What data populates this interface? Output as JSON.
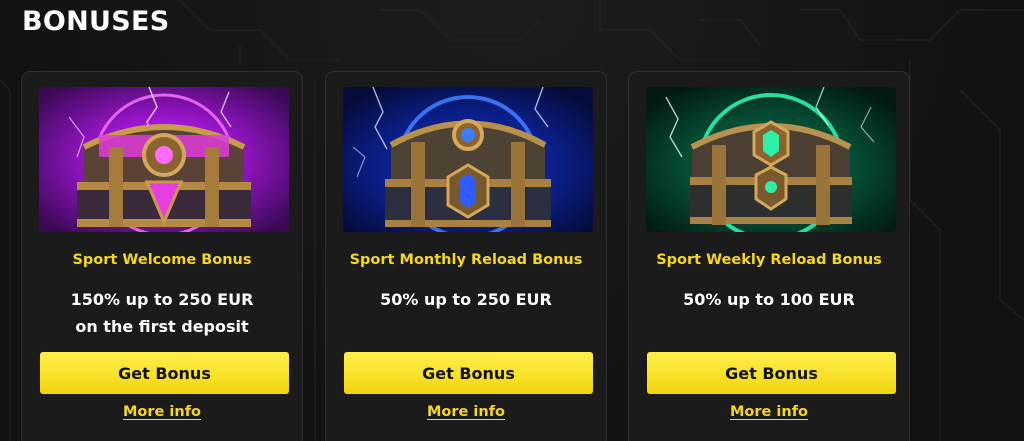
{
  "page": {
    "title": "BONUSES"
  },
  "bonuses": [
    {
      "title": "Sport Welcome Bonus",
      "offer_lines": [
        "150% up to 250 EUR",
        "on the first deposit"
      ],
      "button_label": "Get Bonus",
      "link_label": "More info",
      "image_icon": "purple-treasure-chest",
      "accent_color": "#c23dff"
    },
    {
      "title": "Sport Monthly Reload Bonus",
      "offer_lines": [
        "50% up to 250 EUR"
      ],
      "button_label": "Get Bonus",
      "link_label": "More info",
      "image_icon": "blue-treasure-chest",
      "accent_color": "#2f6bff"
    },
    {
      "title": "Sport Weekly Reload Bonus",
      "offer_lines": [
        "50% up to 100 EUR"
      ],
      "button_label": "Get Bonus",
      "link_label": "More info",
      "image_icon": "green-treasure-chest",
      "accent_color": "#21e39a"
    }
  ],
  "colors": {
    "background": "#141414",
    "card_background": "#1b1b1b",
    "accent_yellow": "#f5d81c",
    "text_white": "#ffffff"
  }
}
